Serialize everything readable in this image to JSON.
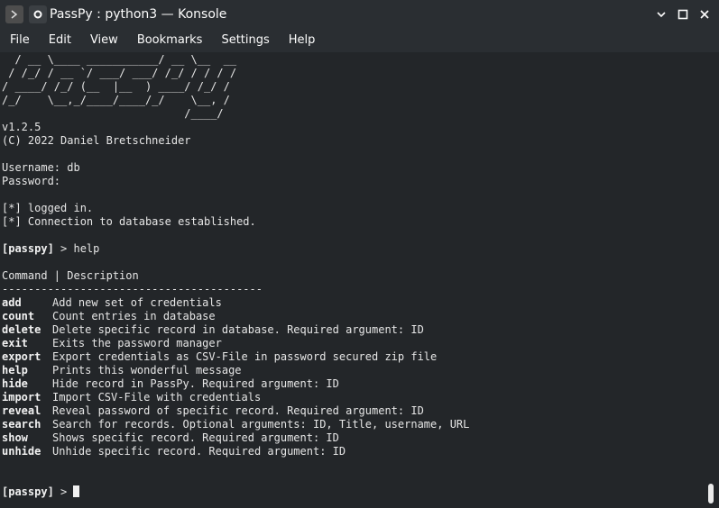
{
  "window": {
    "title": "PassPy : python3 — Konsole"
  },
  "menubar": {
    "items": [
      "File",
      "Edit",
      "View",
      "Bookmarks",
      "Settings",
      "Help"
    ]
  },
  "terminal": {
    "banner": [
      "  / __ \\____ ___________/ __ \\__  __",
      " / /_/ / __ `/ ___/ ___/ /_/ / / / /",
      "/ ____/ /_/ (__  |__  ) ____/ /_/ / ",
      "/_/    \\__,_/____/____/_/    \\__, /  ",
      "                            /____/   "
    ],
    "version": "v1.2.5",
    "copyright": "(C) 2022 Daniel Bretschneider",
    "username_line": "Username: db",
    "password_line": "Password:",
    "logged_in": "[*] logged in.",
    "connection": "[*] Connection to database established.",
    "prompt": "[passpy]",
    "help_command": " > help",
    "table_header": "Command | Description",
    "separator": "----------------------------------------",
    "commands": [
      {
        "name": "add",
        "desc": "Add new set of credentials"
      },
      {
        "name": "count",
        "desc": "Count entries in database"
      },
      {
        "name": "delete",
        "desc": "Delete specific record in database. Required argument: ID"
      },
      {
        "name": "exit",
        "desc": "Exits the password manager"
      },
      {
        "name": "export",
        "desc": "Export credentials as CSV-File in password secured zip file"
      },
      {
        "name": "help",
        "desc": "Prints this wonderful message"
      },
      {
        "name": "hide",
        "desc": "Hide record in PassPy. Required argument: ID"
      },
      {
        "name": "import",
        "desc": "Import CSV-File with credentials"
      },
      {
        "name": "reveal",
        "desc": "Reveal password of specific record. Required argument: ID"
      },
      {
        "name": "search",
        "desc": "Search for records. Optional arguments: ID, Title, username, URL"
      },
      {
        "name": "show",
        "desc": "Shows specific record. Required argument: ID"
      },
      {
        "name": "unhide",
        "desc": "Unhide specific record. Required argument: ID"
      }
    ],
    "final_prompt_suffix": " > "
  }
}
